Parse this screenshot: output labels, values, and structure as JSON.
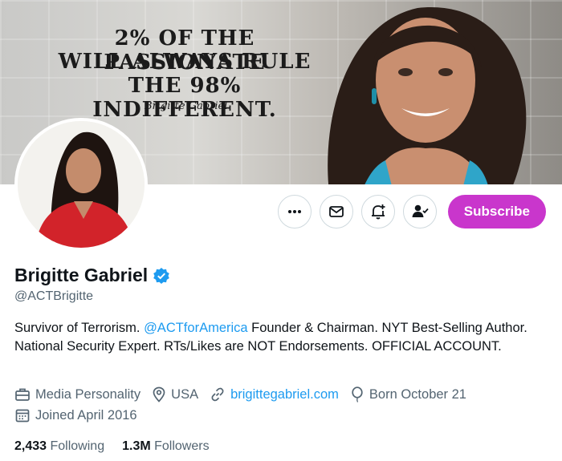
{
  "banner": {
    "quote_line1": "2% OF THE PASSIONATE",
    "quote_line2": "WILL ALWAYS RULE",
    "quote_line3": "THE 98% INDIFFERENT.",
    "signature": "Brigitte Gabriel"
  },
  "profile": {
    "name": "Brigitte Gabriel",
    "handle": "@ACTBrigitte",
    "verified": true,
    "bio_part1": "Survivor of Terrorism. ",
    "bio_mention": "@ACTforAmerica",
    "bio_part2": " Founder & Chairman. NYT Best-Selling Author. National Security Expert. RTs/Likes are NOT Endorsements. OFFICIAL ACCOUNT.",
    "category": "Media Personality",
    "location": "USA",
    "website": "brigittegabriel.com",
    "birthday": "Born October 21",
    "joined": "Joined April 2016"
  },
  "stats": {
    "following_count": "2,433",
    "following_label": "Following",
    "followers_count": "1.3M",
    "followers_label": "Followers"
  },
  "actions": {
    "subscribe_label": "Subscribe"
  },
  "icons": [
    "more-icon",
    "message-icon",
    "notification-bell-icon",
    "following-icon",
    "verified-badge-icon",
    "briefcase-icon",
    "location-pin-icon",
    "link-icon",
    "balloon-icon",
    "calendar-icon"
  ],
  "colors": {
    "accent": "#1d9bf0",
    "subscribe": "#c936cc",
    "secondary_text": "#536471"
  }
}
